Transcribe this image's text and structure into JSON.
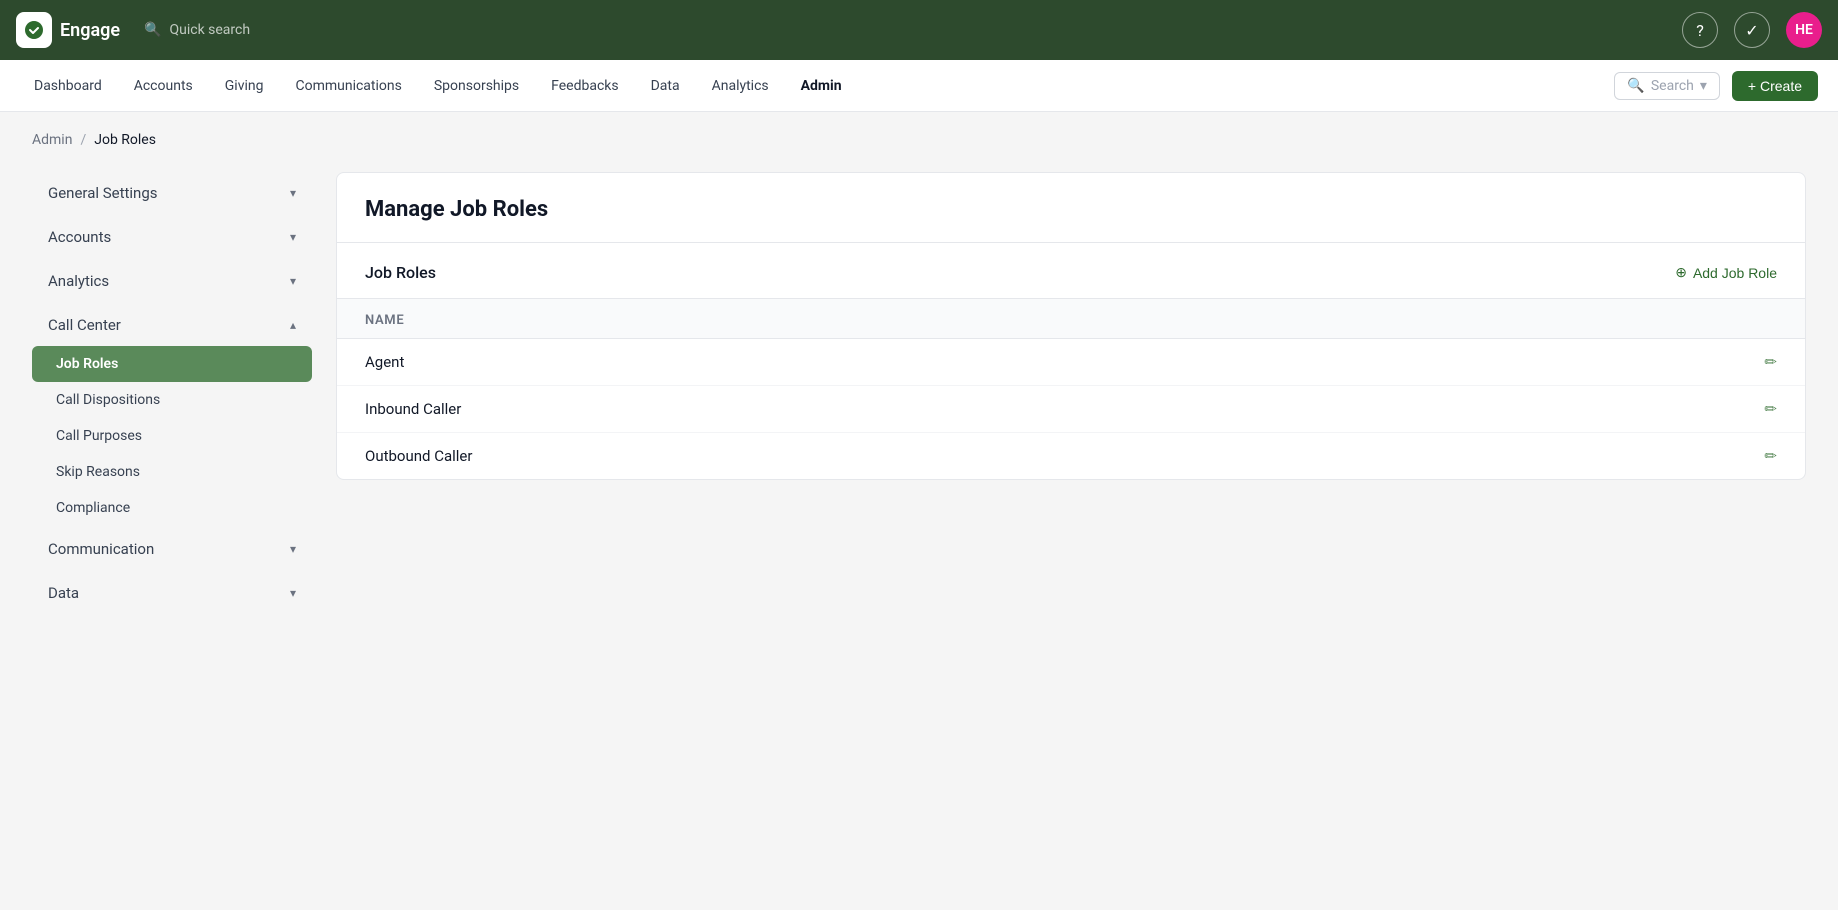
{
  "app": {
    "name": "Engage",
    "logo_alt": "engage-logo"
  },
  "topbar": {
    "search_placeholder": "Quick search",
    "help_icon": "?",
    "avatar_initials": "HE"
  },
  "nav": {
    "items": [
      {
        "label": "Dashboard",
        "key": "dashboard",
        "active": false
      },
      {
        "label": "Accounts",
        "key": "accounts",
        "active": false
      },
      {
        "label": "Giving",
        "key": "giving",
        "active": false
      },
      {
        "label": "Communications",
        "key": "communications",
        "active": false
      },
      {
        "label": "Sponsorships",
        "key": "sponsorships",
        "active": false
      },
      {
        "label": "Feedbacks",
        "key": "feedbacks",
        "active": false
      },
      {
        "label": "Data",
        "key": "data",
        "active": false
      },
      {
        "label": "Analytics",
        "key": "analytics",
        "active": false
      },
      {
        "label": "Admin",
        "key": "admin",
        "active": true
      }
    ],
    "search_label": "Search",
    "create_label": "+ Create"
  },
  "breadcrumb": {
    "parent": "Admin",
    "current": "Job Roles"
  },
  "sidebar": {
    "sections": [
      {
        "label": "General Settings",
        "key": "general-settings",
        "expanded": false,
        "items": []
      },
      {
        "label": "Accounts",
        "key": "accounts",
        "expanded": false,
        "items": []
      },
      {
        "label": "Analytics",
        "key": "analytics",
        "expanded": false,
        "items": []
      },
      {
        "label": "Call Center",
        "key": "call-center",
        "expanded": true,
        "items": [
          {
            "label": "Job Roles",
            "key": "job-roles",
            "active": true
          },
          {
            "label": "Call Dispositions",
            "key": "call-dispositions",
            "active": false
          },
          {
            "label": "Call Purposes",
            "key": "call-purposes",
            "active": false
          },
          {
            "label": "Skip Reasons",
            "key": "skip-reasons",
            "active": false
          },
          {
            "label": "Compliance",
            "key": "compliance",
            "active": false
          }
        ]
      },
      {
        "label": "Communication",
        "key": "communication",
        "expanded": false,
        "items": []
      },
      {
        "label": "Data",
        "key": "data",
        "expanded": false,
        "items": []
      }
    ]
  },
  "main": {
    "title": "Manage Job Roles",
    "section_label": "Job Roles",
    "add_label": "Add Job Role",
    "table_header": "Name",
    "rows": [
      {
        "name": "Agent"
      },
      {
        "name": "Inbound Caller"
      },
      {
        "name": "Outbound Caller"
      }
    ]
  }
}
